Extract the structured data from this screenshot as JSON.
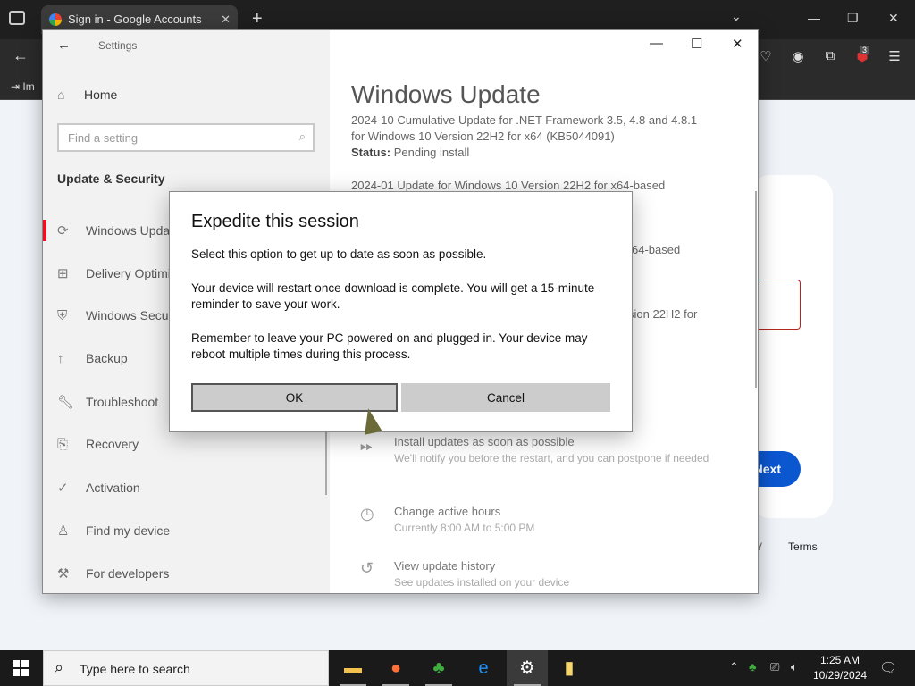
{
  "browser": {
    "tab_title": "Sign in - Google Accounts",
    "bookmark_label": "Im",
    "extension_badge": "3"
  },
  "google": {
    "next_label": "Next",
    "terms_label": "Terms"
  },
  "settings": {
    "window_title": "Settings",
    "home_label": "Home",
    "search_placeholder": "Find a setting",
    "section_title": "Update & Security",
    "nav_items": [
      {
        "label": "Windows Update"
      },
      {
        "label": "Delivery Optimization"
      },
      {
        "label": "Windows Security"
      },
      {
        "label": "Backup"
      },
      {
        "label": "Troubleshoot"
      },
      {
        "label": "Recovery"
      },
      {
        "label": "Activation"
      },
      {
        "label": "Find my device"
      },
      {
        "label": "For developers"
      }
    ],
    "main": {
      "title": "Windows Update",
      "update1_line1": "2024-10 Cumulative Update for .NET Framework 3.5, 4.8 and 4.8.1",
      "update1_line2": "for Windows 10 Version 22H2 for x64 (KB5044091)",
      "status_label": "Status:",
      "status_value": "Pending install",
      "update2_line1": "2024-01 Update for Windows 10 Version 22H2 for x64-based",
      "update3_fragment": "64-based",
      "update4_fragment": "sion 22H2 for",
      "options": [
        {
          "title": "Install updates as soon as possible",
          "sub": "We'll notify you before the restart, and you can postpone if needed"
        },
        {
          "title": "Change active hours",
          "sub": "Currently 8:00 AM to 5:00 PM"
        },
        {
          "title": "View update history",
          "sub": "See updates installed on your device"
        }
      ]
    }
  },
  "dialog": {
    "title": "Expedite this session",
    "p1": "Select this option to get up to date as soon as possible.",
    "p2": "Your device will restart once download is complete. You will get a 15-minute reminder to save your work.",
    "p3": "Remember to leave your PC powered on and plugged in. Your device may reboot multiple times during this process.",
    "ok_label": "OK",
    "cancel_label": "Cancel"
  },
  "taskbar": {
    "search_placeholder": "Type here to search",
    "time": "1:25 AM",
    "date": "10/29/2024"
  }
}
